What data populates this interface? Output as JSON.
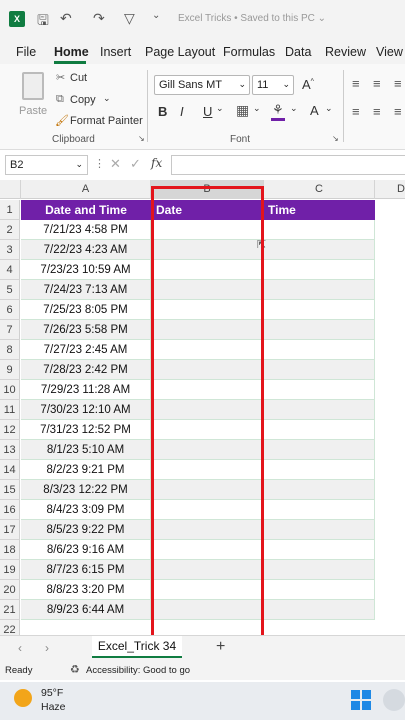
{
  "titlebar": {
    "title": "Excel Tricks  •  Saved to this PC ⌄"
  },
  "menu": [
    "File",
    "Home",
    "Insert",
    "Page Layout",
    "Formulas",
    "Data",
    "Review",
    "View"
  ],
  "ribbon": {
    "paste": "Paste",
    "cut": "Cut",
    "copy": "Copy",
    "format_painter": "Format Painter",
    "clipboard_label": "Clipboard",
    "font_name": "Gill Sans MT",
    "font_size": "11",
    "bold": "B",
    "italic": "I",
    "underline": "U",
    "font_label": "Font"
  },
  "formula_bar": {
    "name_box": "B2",
    "fx": "fx"
  },
  "columns": [
    "A",
    "B",
    "C",
    "D"
  ],
  "header_row": {
    "date_and_time": "Date and Time",
    "date": "Date",
    "time": "Time"
  },
  "rows": [
    {
      "n": "1"
    },
    {
      "n": "2",
      "a": "7/21/23 4:58 PM"
    },
    {
      "n": "3",
      "a": "7/22/23 4:23 AM"
    },
    {
      "n": "4",
      "a": "7/23/23 10:59 AM"
    },
    {
      "n": "5",
      "a": "7/24/23 7:13 AM"
    },
    {
      "n": "6",
      "a": "7/25/23 8:05 PM"
    },
    {
      "n": "7",
      "a": "7/26/23 5:58 PM"
    },
    {
      "n": "8",
      "a": "7/27/23 2:45 AM"
    },
    {
      "n": "9",
      "a": "7/28/23 2:42 PM"
    },
    {
      "n": "10",
      "a": "7/29/23 11:28 AM"
    },
    {
      "n": "11",
      "a": "7/30/23 12:10 AM"
    },
    {
      "n": "12",
      "a": "7/31/23 12:52 PM"
    },
    {
      "n": "13",
      "a": "8/1/23 5:10 AM"
    },
    {
      "n": "14",
      "a": "8/2/23 9:21 PM"
    },
    {
      "n": "15",
      "a": "8/3/23 12:22 PM"
    },
    {
      "n": "16",
      "a": "8/4/23 3:09 PM"
    },
    {
      "n": "17",
      "a": "8/5/23 9:22 PM"
    },
    {
      "n": "18",
      "a": "8/6/23 9:16 AM"
    },
    {
      "n": "19",
      "a": "8/7/23 6:15 PM"
    },
    {
      "n": "20",
      "a": "8/8/23 3:20 PM"
    },
    {
      "n": "21",
      "a": "8/9/23 6:44 AM"
    },
    {
      "n": "22"
    }
  ],
  "sheet_tab": "Excel_Trick 34",
  "status": {
    "ready": "Ready",
    "accessibility": "Accessibility: Good to go"
  },
  "weather": {
    "temp": "95°F",
    "condition": "Haze"
  },
  "colors": {
    "header_purple": "#7020a8",
    "highlight_red": "#e3141b",
    "excel_green": "#107c41"
  }
}
